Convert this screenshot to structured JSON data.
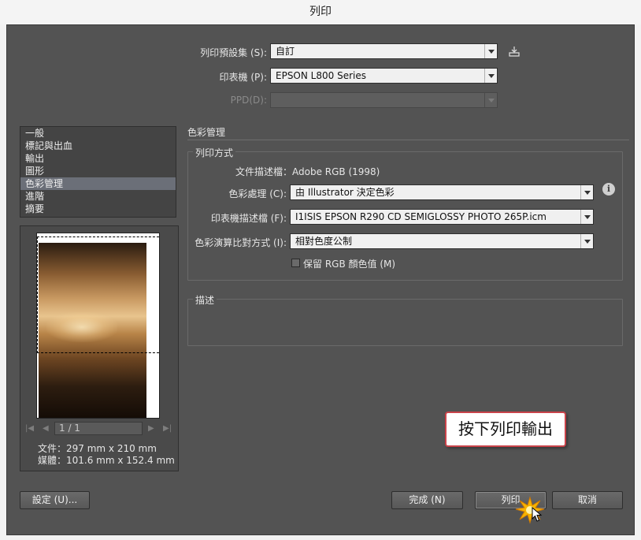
{
  "window": {
    "title": "列印"
  },
  "header": {
    "preset_label": "列印預設集 (S):",
    "preset_value": "自訂",
    "printer_label": "印表機 (P):",
    "printer_value": "EPSON L800 Series",
    "ppd_label": "PPD(D):",
    "ppd_value": ""
  },
  "sidebar": {
    "items": [
      {
        "label": "一般"
      },
      {
        "label": "標記與出血"
      },
      {
        "label": "輸出"
      },
      {
        "label": "圖形"
      },
      {
        "label": "色彩管理"
      },
      {
        "label": "進階"
      },
      {
        "label": "摘要"
      }
    ],
    "selected_index": 4
  },
  "preview": {
    "page_field": "1 / 1",
    "document_size": "文件：297 mm x 210 mm",
    "media_size": "媒體：101.6 mm x 152.4 mm"
  },
  "section": {
    "title": "色彩管理",
    "print_method": {
      "legend": "列印方式",
      "doc_profile": "文件描述檔：Adobe RGB (1998)",
      "color_handling_label": "色彩處理 (C):",
      "color_handling_value": "由 Illustrator 決定色彩",
      "printer_profile_label": "印表機描述檔 (F):",
      "printer_profile_value": "I1ISIS EPSON R290 CD SEMIGLOSSY PHOTO 265P.icm",
      "rendering_intent_label": "色彩演算比對方式 (I):",
      "rendering_intent_value": "相對色度公制",
      "preserve_rgb_label": "保留 RGB 顏色值 (M)",
      "preserve_rgb_checked": false
    },
    "description": {
      "legend": "描述"
    }
  },
  "footer": {
    "setup_button": "設定 (U)...",
    "done_button": "完成 (N)",
    "print_button": "列印",
    "cancel_button": "取消"
  },
  "annotation": {
    "callout_text": "按下列印輸出"
  },
  "colors": {
    "dialog_bg": "#535353",
    "selected_item": "#6b6f78",
    "callout_border": "#c9434a"
  },
  "icons": [
    "save-preset-icon",
    "info-icon",
    "first-page-icon",
    "prev-page-icon",
    "next-page-icon",
    "last-page-icon",
    "cursor-icon",
    "click-burst-icon"
  ]
}
